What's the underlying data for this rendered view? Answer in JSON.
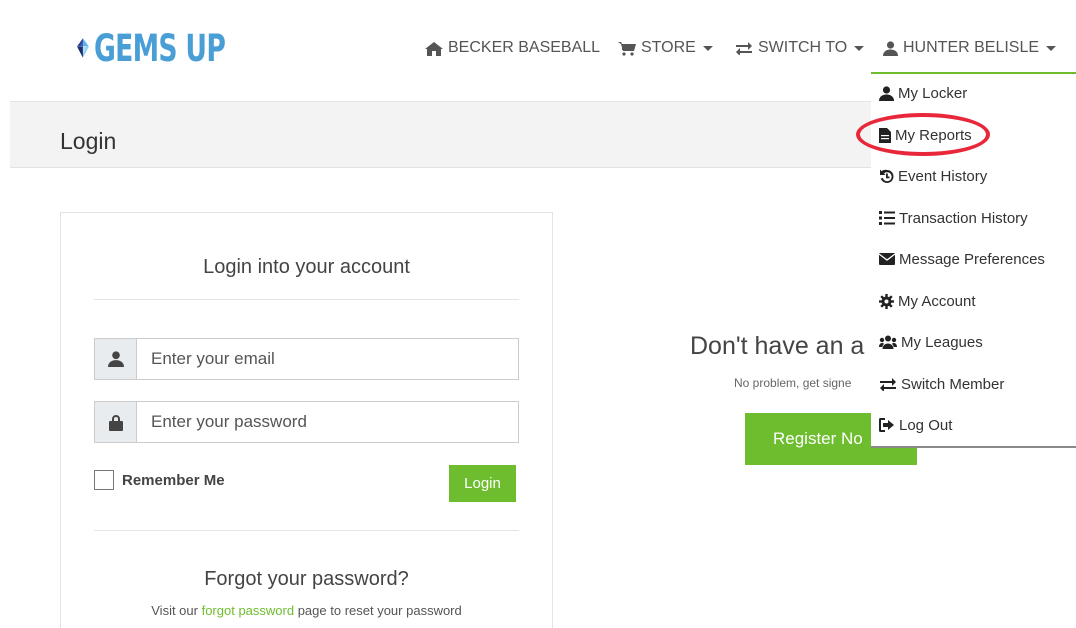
{
  "brand": {
    "logo_text": "GEMS UP"
  },
  "nav": {
    "home_label": "BECKER BASEBALL",
    "store_label": "STORE",
    "switch_label": "SWITCH TO",
    "user_label": "HUNTER BELISLE"
  },
  "page": {
    "title": "Login"
  },
  "login": {
    "heading": "Login into your account",
    "email_placeholder": "Enter your email",
    "password_placeholder": "Enter your password",
    "remember_label": "Remember Me",
    "submit_label": "Login",
    "forgot_title": "Forgot your password?",
    "forgot_prefix": "Visit our ",
    "forgot_link": "forgot password",
    "forgot_suffix": " page to reset your password"
  },
  "signup": {
    "title": "Don't have an a",
    "text": "No problem, get signe",
    "button_label": "Register No"
  },
  "user_menu": {
    "items": [
      {
        "label": "My Locker",
        "icon": "user-icon"
      },
      {
        "label": "My Reports",
        "icon": "file-icon"
      },
      {
        "label": "Event History",
        "icon": "history-icon"
      },
      {
        "label": "Transaction History",
        "icon": "list-icon"
      },
      {
        "label": "Message Preferences",
        "icon": "envelope-icon"
      },
      {
        "label": "My Account",
        "icon": "gear-icon"
      },
      {
        "label": "My Leagues",
        "icon": "users-icon"
      },
      {
        "label": "Switch Member",
        "icon": "exchange-icon"
      },
      {
        "label": "Log Out",
        "icon": "sign-out-icon"
      }
    ]
  },
  "colors": {
    "accent_green": "#6ebd2e",
    "highlight_red": "#e8283a",
    "logo_blue": "#4a9ed6"
  }
}
